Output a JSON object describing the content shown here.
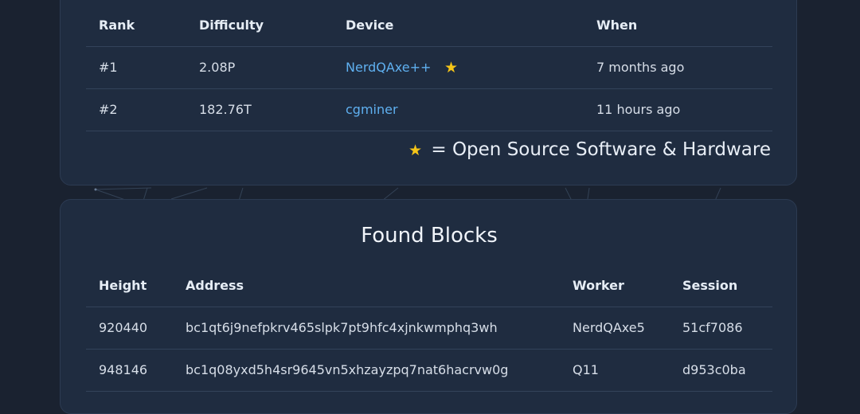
{
  "best_shares": {
    "columns": [
      "Rank",
      "Difficulty",
      "Device",
      "When"
    ],
    "rows": [
      {
        "rank": "#1",
        "difficulty": "2.08P",
        "device": "NerdQAxe++",
        "open_source": true,
        "when": "7 months ago"
      },
      {
        "rank": "#2",
        "difficulty": "182.76T",
        "device": "cgminer",
        "open_source": false,
        "when": "11 hours ago"
      }
    ],
    "legend_star": "★",
    "legend_text": "= Open Source Software & Hardware"
  },
  "found_blocks": {
    "title": "Found Blocks",
    "columns": [
      "Height",
      "Address",
      "Worker",
      "Session"
    ],
    "rows": [
      {
        "height": "920440",
        "address": "bc1qt6j9nefpkrv465slpk7pt9hfc4xjnkwmphq3wh",
        "worker": "NerdQAxe5",
        "session": "51cf7086"
      },
      {
        "height": "948146",
        "address": "bc1q08yxd5h4sr9645vn5xhzayzpq7nat6hacrvw0g",
        "worker": "Q11",
        "session": "d953c0ba"
      }
    ]
  },
  "colors": {
    "background": "#1a2230",
    "card": "#1f2c40",
    "link": "#5fb0f0",
    "star": "#f5c518"
  }
}
